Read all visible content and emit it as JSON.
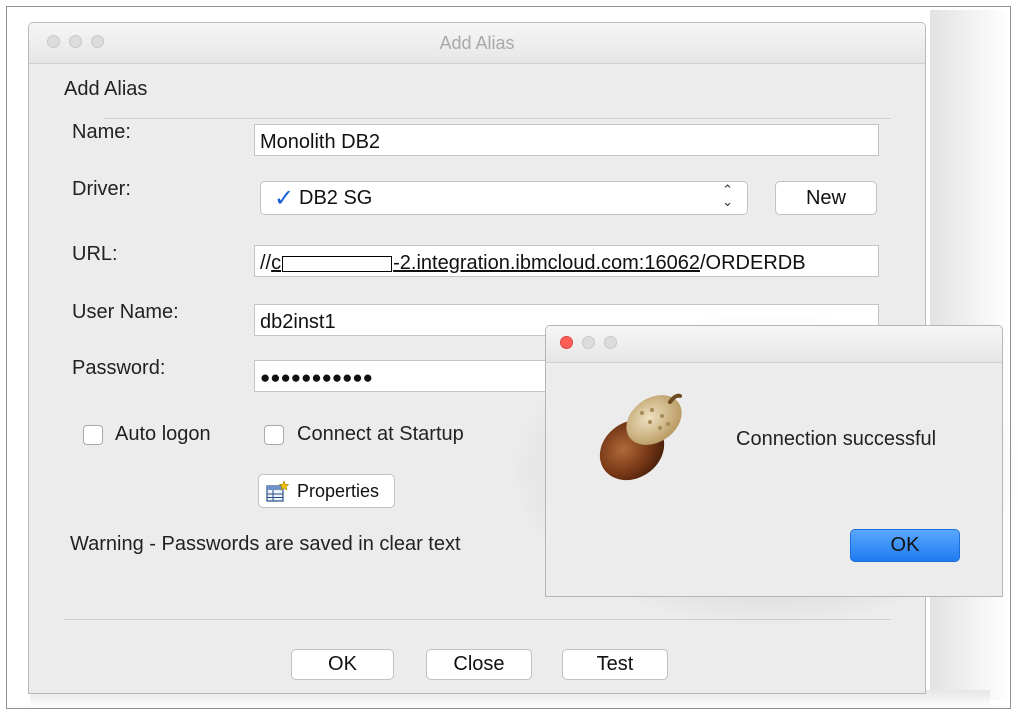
{
  "main_window": {
    "title": "Add Alias",
    "section_label": "Add Alias",
    "fields": {
      "name_label": "Name:",
      "name_value": "Monolith DB2",
      "driver_label": "Driver:",
      "driver_value": "DB2 SG",
      "new_button": "New",
      "url_label": "URL:",
      "url_prefix": "//",
      "url_part1": "c",
      "url_suffix": "-2.integration.ibmcloud.com:16062",
      "url_tail": "/ORDERDB",
      "username_label": "User Name:",
      "username_value": "db2inst1",
      "password_label": "Password:",
      "password_value": "●●●●●●●●●●●"
    },
    "options": {
      "auto_logon": "Auto logon",
      "connect_startup": "Connect at Startup",
      "properties_button": "Properties"
    },
    "warning": "Warning - Passwords are saved in clear text",
    "buttons": {
      "ok": "OK",
      "close": "Close",
      "test": "Test"
    }
  },
  "dialog": {
    "message": "Connection successful",
    "ok": "OK",
    "icon": "acorn-icon"
  },
  "colors": {
    "accent": "#1f7bf0",
    "close_red": "#ff5f57",
    "window_bg": "#ececec"
  }
}
